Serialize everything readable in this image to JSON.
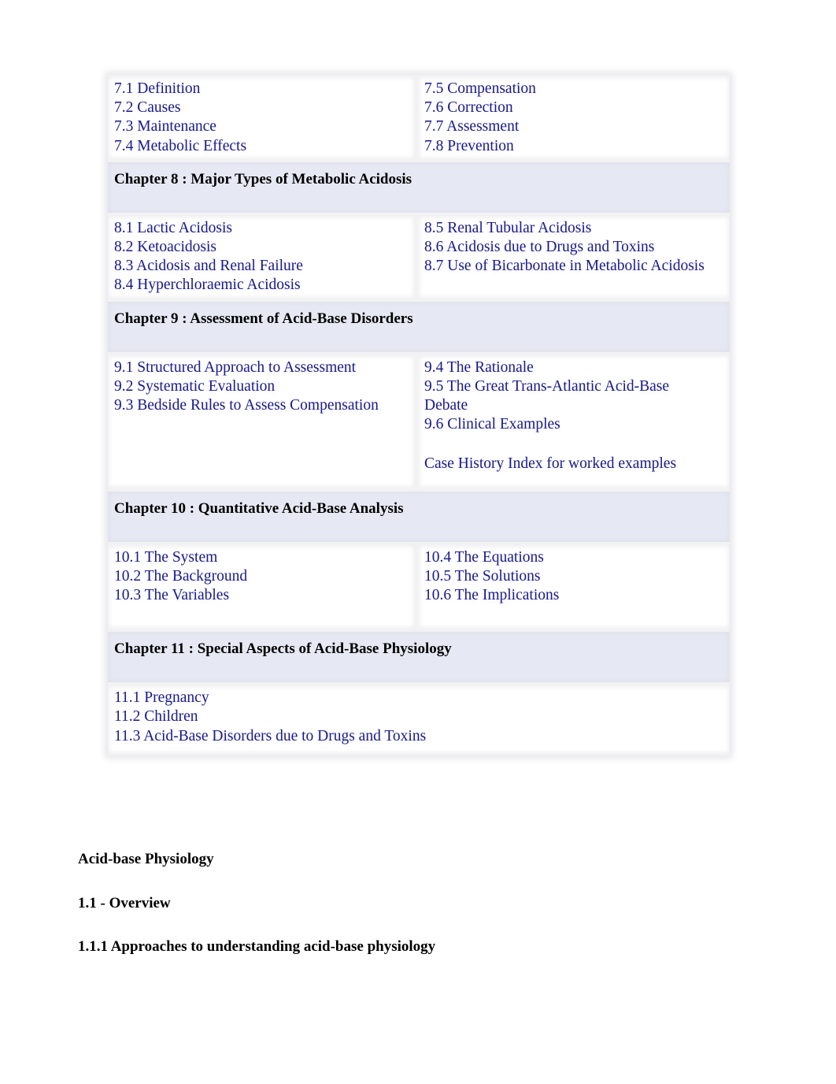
{
  "toc": {
    "chapter7": {
      "left": [
        "7.1 Definition",
        "7.2 Causes",
        "7.3 Maintenance",
        "7.4 Metabolic Effects"
      ],
      "right": [
        "7.5 Compensation",
        "7.6 Correction",
        "7.7 Assessment",
        "7.8 Prevention"
      ]
    },
    "chapter8": {
      "title": "Chapter 8 : Major Types of Metabolic Acidosis",
      "left": [
        "8.1 Lactic Acidosis",
        "8.2 Ketoacidosis",
        "8.3 Acidosis and Renal Failure",
        "8.4 Hyperchloraemic Acidosis"
      ],
      "right": [
        "8.5 Renal Tubular Acidosis",
        "8.6 Acidosis due to Drugs and Toxins",
        "8.7 Use of Bicarbonate in Metabolic Acidosis"
      ]
    },
    "chapter9": {
      "title": "Chapter 9 : Assessment of Acid-Base Disorders",
      "left": [
        "9.1 Structured Approach to Assessment",
        "9.2 Systematic Evaluation",
        "9.3 Bedside Rules to Assess Compensation"
      ],
      "right": [
        "9.4 The Rationale",
        "9.5 The Great Trans-Atlantic Acid-Base Debate",
        "9.6 Clinical Examples"
      ],
      "extra_link": "Case History Index for worked examples"
    },
    "chapter10": {
      "title": "Chapter 10 : Quantitative Acid-Base Analysis",
      "left": [
        "10.1 The System",
        "10.2 The Background",
        "10.3 The Variables"
      ],
      "right": [
        "10.4 The Equations",
        "10.5 The Solutions",
        "10.6 The Implications"
      ]
    },
    "chapter11": {
      "title": "Chapter 11 : Special Aspects of Acid-Base Physiology",
      "items": [
        "11.1 Pregnancy",
        "11.2 Children",
        "11.3 Acid-Base Disorders due to Drugs and Toxins"
      ]
    }
  },
  "body": {
    "title": "Acid-base Physiology",
    "section": "1.1 - Overview",
    "subsection": "1.1.1 Approaches to understanding acid-base physiology"
  },
  "colors": {
    "link": "#1a1a8c",
    "chapter_bg": "#e6e8f3"
  }
}
